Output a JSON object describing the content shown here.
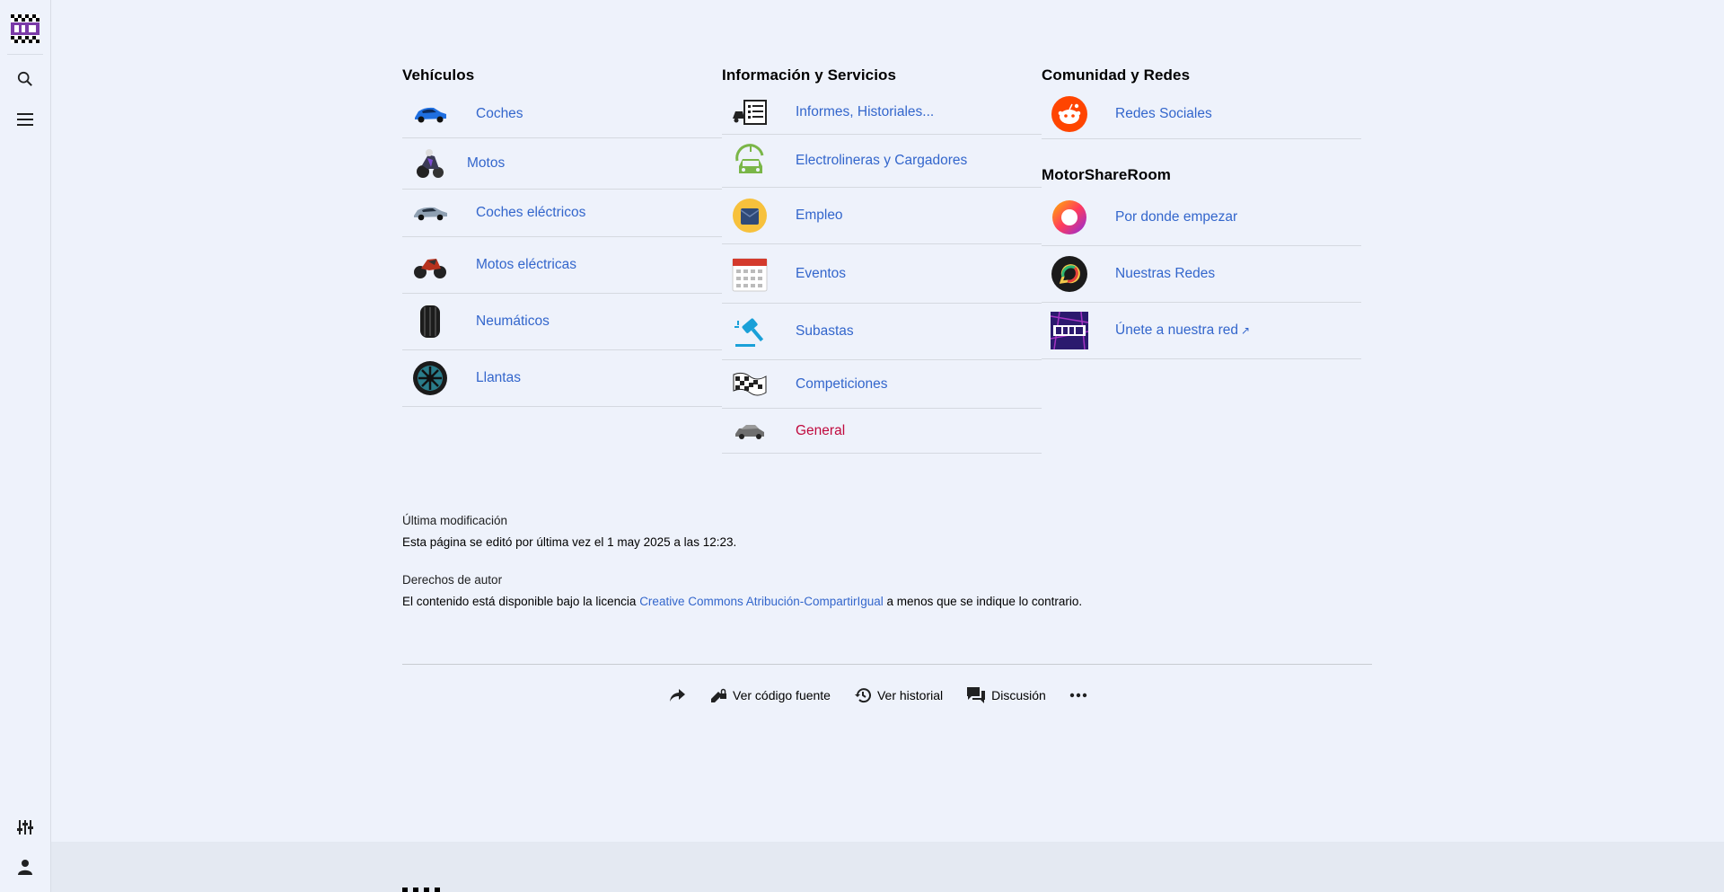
{
  "sidebar": {
    "logo_icon": "checkered-flag-logo",
    "search_icon": "search-icon",
    "menu_icon": "menu-icon",
    "settings_icon": "sliders-icon",
    "user_icon": "user-icon"
  },
  "columns": {
    "vehiculos": {
      "title": "Vehículos",
      "items": [
        {
          "label": "Coches",
          "icon": "blue-car-icon"
        },
        {
          "label": "Motos",
          "icon": "motorcycle-icon"
        },
        {
          "label": "Coches eléctricos",
          "icon": "electric-car-icon"
        },
        {
          "label": "Motos eléctricas",
          "icon": "electric-motorcycle-icon"
        },
        {
          "label": "Neumáticos",
          "icon": "tire-icon"
        },
        {
          "label": "Llantas",
          "icon": "rim-icon"
        }
      ]
    },
    "info": {
      "title": "Información y Servicios",
      "items": [
        {
          "label": "Informes, Historiales...",
          "icon": "report-icon"
        },
        {
          "label": "Electrolineras y Cargadores",
          "icon": "charger-icon"
        },
        {
          "label": "Empleo",
          "icon": "job-icon"
        },
        {
          "label": "Eventos",
          "icon": "calendar-icon"
        },
        {
          "label": "Subastas",
          "icon": "gavel-icon"
        },
        {
          "label": "Competiciones",
          "icon": "racing-flag-icon"
        },
        {
          "label": "General",
          "icon": "cars-icon"
        }
      ]
    },
    "comunidad": {
      "title": "Comunidad y Redes",
      "items": [
        {
          "label": "Redes Sociales",
          "icon": "reddit-icon"
        }
      ]
    },
    "msr": {
      "title": "MotorShareRoom",
      "items": [
        {
          "label": "Por donde empezar",
          "icon": "ring-icon"
        },
        {
          "label": "Nuestras Redes",
          "icon": "chat-bubble-icon"
        },
        {
          "label": "Únete a nuestra red",
          "icon": "room-logo-icon"
        }
      ]
    }
  },
  "footer": {
    "last_mod_label": "Última modificación",
    "last_mod_text": "Esta página se editó por última vez el 1 may 2025 a las 12:23.",
    "rights_label": "Derechos de autor",
    "rights_prefix": "El contenido está disponible bajo la licencia ",
    "rights_link": "Creative Commons Atribución-CompartirIgual",
    "rights_suffix": " a menos que se indique lo contrario."
  },
  "actions": {
    "share_icon": "share-icon",
    "source_label": "Ver código fuente",
    "history_label": "Ver historial",
    "discussion_label": "Discusión",
    "more_icon": "more-icon"
  },
  "colors": {
    "link": "#3366cc",
    "link_new": "#c0093d",
    "background": "#eef2fb"
  }
}
